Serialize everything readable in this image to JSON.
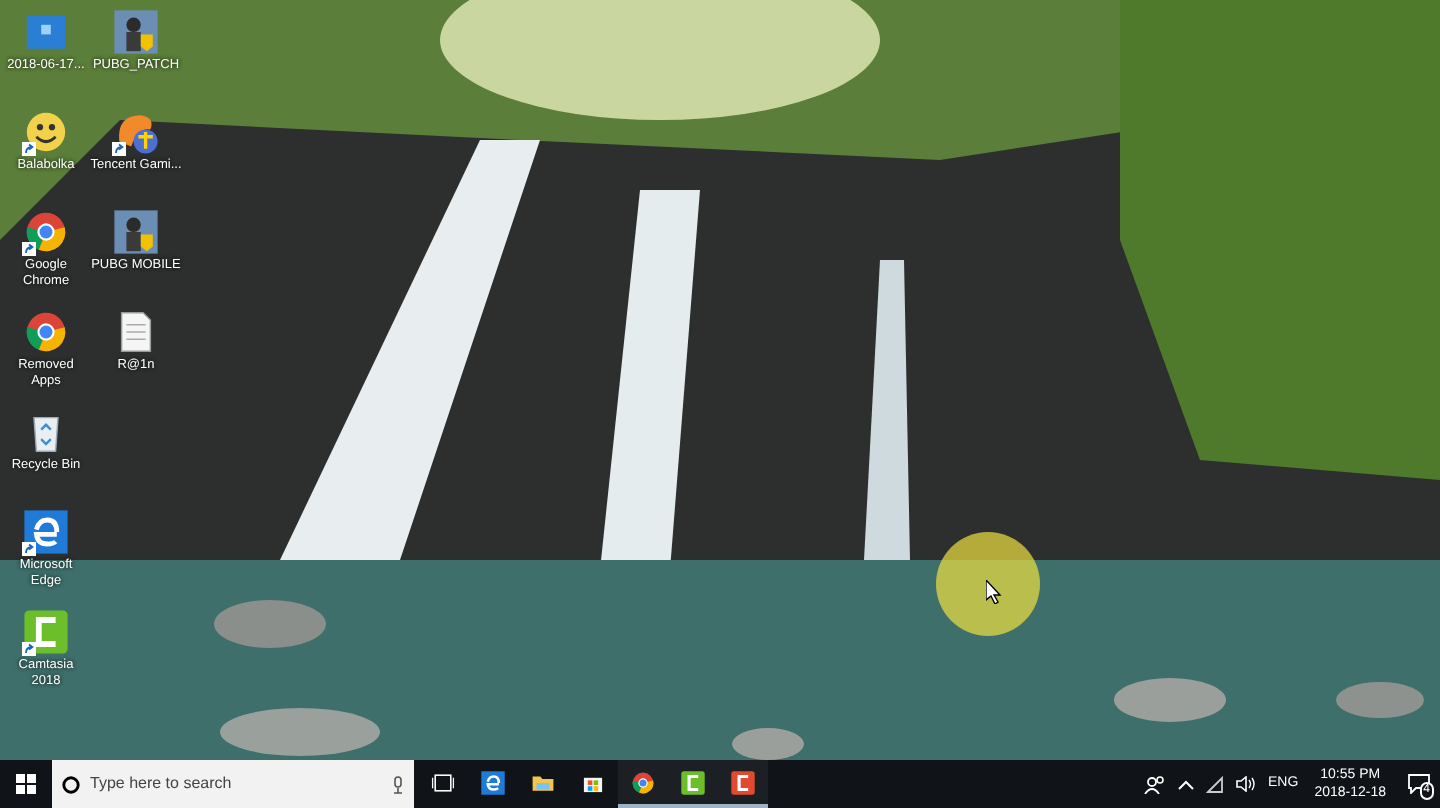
{
  "desktop": {
    "icons": [
      {
        "label": "2018-06-17...",
        "kind": "image",
        "shortcut": false
      },
      {
        "label": "Balabolka",
        "kind": "smiley",
        "shortcut": true
      },
      {
        "label": "Google Chrome",
        "kind": "chrome",
        "shortcut": true
      },
      {
        "label": "Removed Apps",
        "kind": "chrome",
        "shortcut": false
      },
      {
        "label": "Recycle Bin",
        "kind": "recycle",
        "shortcut": false
      },
      {
        "label": "Microsoft Edge",
        "kind": "edge",
        "shortcut": true
      },
      {
        "label": "Camtasia 2018",
        "kind": "camtasia",
        "shortcut": true
      },
      {
        "label": "PUBG_PATCH",
        "kind": "game",
        "shortcut": false
      },
      {
        "label": "Tencent Gami...",
        "kind": "tencent",
        "shortcut": true
      },
      {
        "label": "PUBG MOBILE",
        "kind": "game",
        "shortcut": false
      },
      {
        "label": "R@1n",
        "kind": "document",
        "shortcut": false
      }
    ]
  },
  "taskbar": {
    "search": {
      "placeholder": "Type here to search"
    },
    "apps": [
      {
        "kind": "taskview",
        "running": false
      },
      {
        "kind": "edge",
        "running": false
      },
      {
        "kind": "folder",
        "running": false
      },
      {
        "kind": "store",
        "running": false
      },
      {
        "kind": "chrome",
        "running": true
      },
      {
        "kind": "camtasia",
        "running": true
      },
      {
        "kind": "camtasia-red",
        "running": true
      }
    ],
    "tray": {
      "language": "ENG",
      "time": "10:55 PM",
      "date": "2018-12-18",
      "notifications": "4"
    }
  }
}
